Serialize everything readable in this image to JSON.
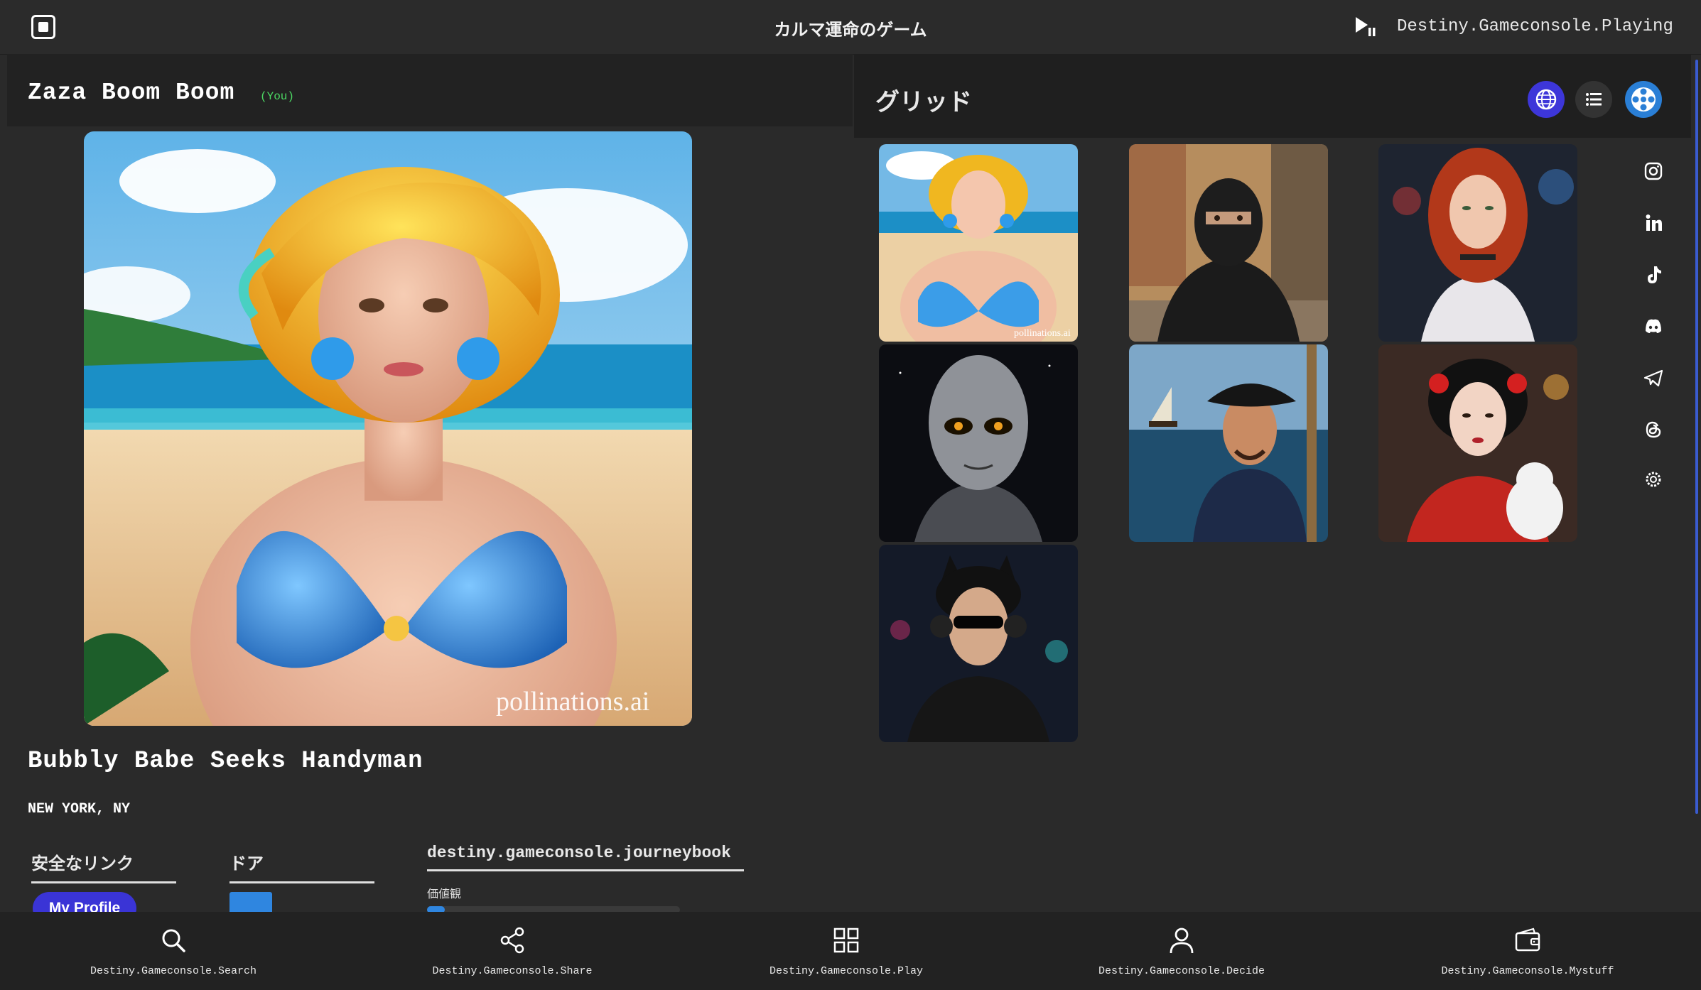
{
  "topbar": {
    "title": "カルマ運命のゲーム",
    "status_text": "Destiny.Gameconsole.Playing"
  },
  "profile": {
    "name": "Zaza Boom Boom",
    "you_tag": "(You)",
    "image_watermark": "pollinations.ai",
    "headline": "Bubbly Babe Seeks Handyman",
    "location": "NEW YORK, NY",
    "safe_links_heading": "安全なリンク",
    "door_heading": "ドア",
    "journeybook_heading": "destiny.gameconsole.journeybook",
    "my_profile_button": "My Profile",
    "value_label": "価値観",
    "value_fraction": 0.07
  },
  "grid": {
    "title": "グリッド",
    "thumbnails": [
      {
        "name": "blonde-beach-character",
        "watermark": "pollinations.ai"
      },
      {
        "name": "masked-ninja-character",
        "watermark": ""
      },
      {
        "name": "redhead-woman-character",
        "watermark": ""
      },
      {
        "name": "silver-alien-character",
        "watermark": ""
      },
      {
        "name": "pirate-character",
        "watermark": ""
      },
      {
        "name": "geisha-with-cat-character",
        "watermark": ""
      },
      {
        "name": "cat-ear-headphones-man-character",
        "watermark": ""
      }
    ]
  },
  "social_icons": [
    "instagram-icon",
    "linkedin-icon",
    "tiktok-icon",
    "discord-icon",
    "telegram-icon",
    "threads-icon",
    "settings-icon"
  ],
  "bottom_nav": [
    {
      "label": "Destiny.Gameconsole.Search",
      "icon": "search-icon"
    },
    {
      "label": "Destiny.Gameconsole.Share",
      "icon": "share-icon"
    },
    {
      "label": "Destiny.Gameconsole.Play",
      "icon": "grid-icon"
    },
    {
      "label": "Destiny.Gameconsole.Decide",
      "icon": "person-icon"
    },
    {
      "label": "Destiny.Gameconsole.Mystuff",
      "icon": "wallet-icon"
    }
  ],
  "colors": {
    "background": "#2a2a2a",
    "accent_blue": "#3a34d6",
    "you_green": "#4cd964",
    "progress_blue": "#2f86e0"
  }
}
